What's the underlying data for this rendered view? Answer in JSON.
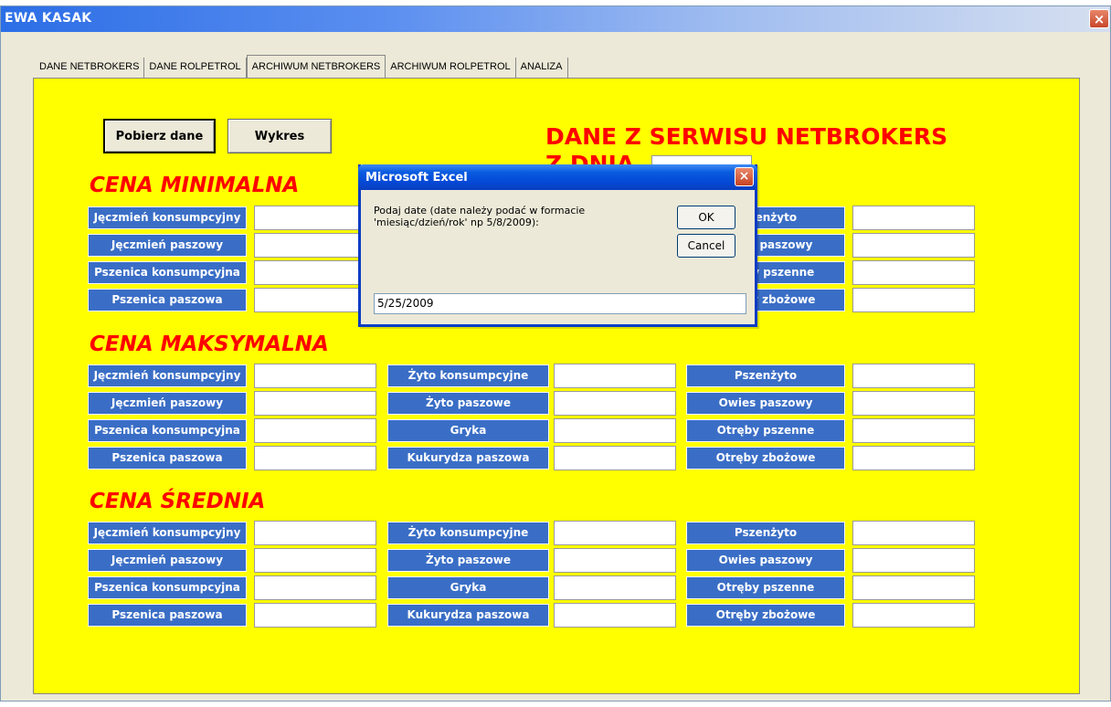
{
  "window": {
    "title": "EWA KASAK",
    "close_glyph": "×"
  },
  "tabs": [
    {
      "label": "DANE NETBROKERS",
      "selected": false
    },
    {
      "label": "DANE ROLPETROL",
      "selected": false
    },
    {
      "label": "ARCHIWUM NETBROKERS",
      "selected": true
    },
    {
      "label": "ARCHIWUM ROLPETROL",
      "selected": false
    },
    {
      "label": "ANALIZA",
      "selected": false
    }
  ],
  "buttons": {
    "pobierz": "Pobierz dane",
    "wykres": "Wykres"
  },
  "heading": {
    "line1": "DANE Z SERWISU NETBROKERS",
    "line2": "Z DNIA"
  },
  "sections": {
    "min": "CENA MINIMALNA",
    "max": "CENA MAKSYMALNA",
    "avg": "CENA ŚREDNIA"
  },
  "labels": {
    "col1": [
      "Jęczmień konsumpcyjny",
      "Jęczmień paszowy",
      "Pszenica konsumpcyjna",
      "Pszenica paszowa"
    ],
    "col2": [
      "Żyto konsumpcyjne",
      "Żyto paszowe",
      "Gryka",
      "Kukurydza paszowa"
    ],
    "col3": [
      "Pszenżyto",
      "Owies paszowy",
      "Otręby pszenne",
      "Otręby zbożowe"
    ]
  },
  "dialog": {
    "title": "Microsoft Excel",
    "message": "Podaj date (date należy podać w formacie 'miesiąc/dzień/rok' np 5/8/2009):",
    "ok": "OK",
    "cancel": "Cancel",
    "input_value": "5/25/2009",
    "close_glyph": "×"
  },
  "colors": {
    "panel": "#ffff00",
    "label_bg": "#3a6ec6",
    "heading": "#ff0000"
  },
  "icons": {
    "close": "close-icon"
  }
}
